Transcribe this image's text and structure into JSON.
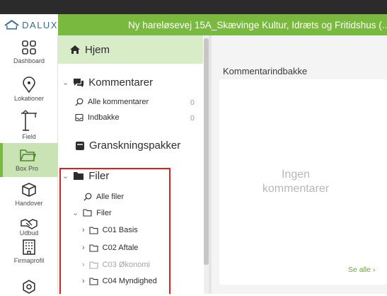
{
  "header": {
    "logo_text": "DALUX",
    "project_title": "Ny hareløsevej 15A_Skævinge Kultur, Idræts og Fritidshus (..."
  },
  "rail": {
    "items": [
      {
        "label": "Dashboard",
        "icon": "dashboard-icon"
      },
      {
        "label": "Lokationer",
        "icon": "location-icon"
      },
      {
        "label": "Field",
        "icon": "crane-icon"
      },
      {
        "label": "Box Pro",
        "icon": "folder-open-icon"
      },
      {
        "label": "Handover",
        "icon": "box-icon"
      },
      {
        "label": "Udbud",
        "icon": "handshake-icon"
      },
      {
        "label": "Firmaprofil",
        "icon": "building-icon"
      },
      {
        "label": "",
        "icon": "settings-icon"
      }
    ],
    "active_index": 3
  },
  "tree": {
    "home_label": "Hjem",
    "comments_label": "Kommentarer",
    "all_comments_label": "Alle kommentarer",
    "all_comments_count": "0",
    "inbox_label": "Indbakke",
    "inbox_count": "0",
    "review_packages_label": "Granskningspakker",
    "files_label": "Filer",
    "all_files_label": "Alle filer",
    "files_folder_label": "Filer",
    "folders": [
      {
        "label": "C01 Basis",
        "muted": false
      },
      {
        "label": "C02 Aftale",
        "muted": false
      },
      {
        "label": "C03 Økonomi",
        "muted": true
      },
      {
        "label": "C04 Myndighed",
        "muted": false
      }
    ]
  },
  "main": {
    "title": "Kommentarindbakke",
    "empty_line1": "Ingen",
    "empty_line2": "kommentarer",
    "see_all": "Se alle ›"
  },
  "colors": {
    "brand_green": "#7ab93f",
    "selected_rail_bg": "#c9e3b5",
    "home_row_bg": "#d8ecc8",
    "highlight_border": "#e02020"
  }
}
